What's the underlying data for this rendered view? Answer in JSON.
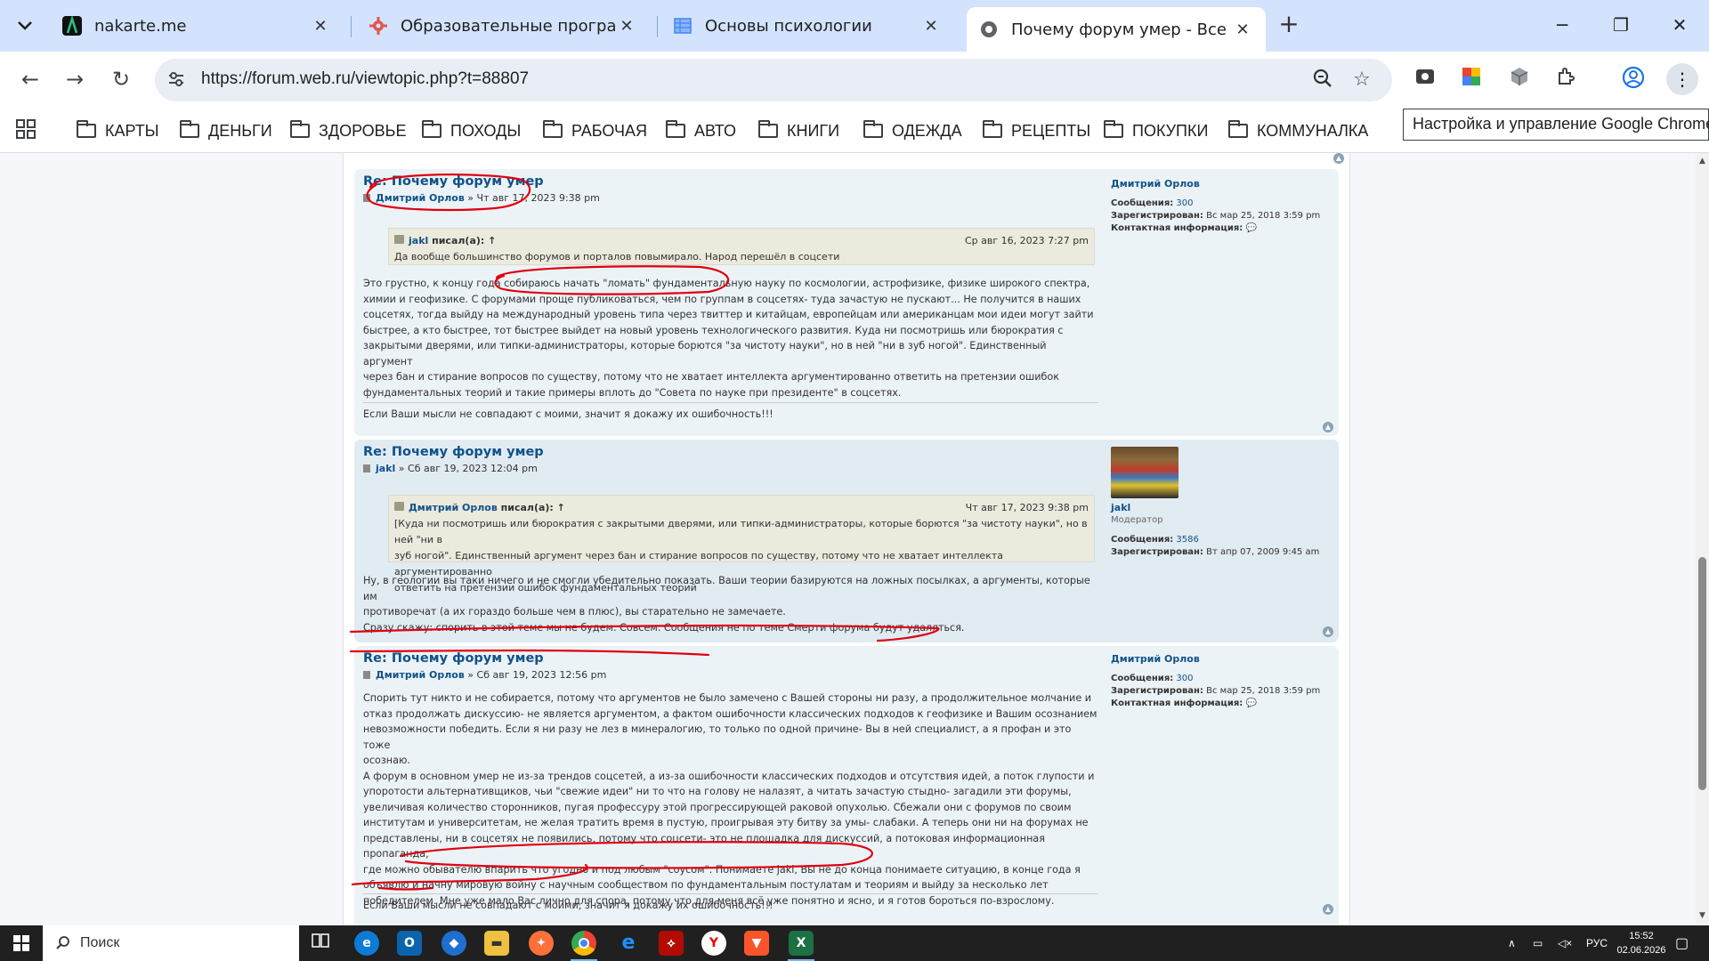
{
  "browser": {
    "tabs": [
      {
        "title": "nakarte.me",
        "favicon": "nakarte-icon",
        "active": false
      },
      {
        "title": "Образовательные программы",
        "favicon": "gear-red-icon",
        "active": false
      },
      {
        "title": "Основы психологии",
        "favicon": "document-grid-icon",
        "active": false
      },
      {
        "title": "Почему форум умер - Все о ге",
        "favicon": "globe-icon",
        "active": true
      }
    ],
    "url": "https://forum.web.ru/viewtopic.php?t=88807",
    "bookmarks": [
      "КАРТЫ",
      "ДЕНЬГИ",
      "ЗДОРОВЬЕ",
      "ПОХОДЫ",
      "РАБОЧАЯ",
      "АВТО",
      "КНИГИ",
      "ОДЕЖДА",
      "РЕЦЕПТЫ",
      "ПОКУПКИ",
      "КОММУНАЛКА"
    ],
    "tooltip": "Настройка и управление Google Chrome"
  },
  "posts": [
    {
      "title": "Re: Почему форум умер",
      "author": "Дмитрий Орлов",
      "date": "» Чт авг 17, 2023 9:38 pm",
      "quote": {
        "author": "jakl",
        "wrote": "писал(а): ↑",
        "date": "Ср авг 16, 2023 7:27 pm",
        "text": "Да вообще большинство форумов и порталов повымирало. Народ перешёл в соцсети"
      },
      "lines": [
        "Это грустно, к концу года собираюсь начать \"ломать\" фундаментальную науку по космологии, астрофизике, физике широкого спектра,",
        "химии и геофизике. С форумами проще публиковаться, чем по группам в соцсетях- туда зачастую не пускают... Не получится в наших",
        "соцсетях, тогда выйду на международный уровень типа через твиттер и китайцам, европейцам или американцам мои идеи могут зайти",
        "быстрее, а кто быстрее, тот быстрее выйдет на новый уровень технологического развития. Куда ни посмотришь или бюрократия с",
        "закрытыми дверями, или типки-администраторы, которые борются \"за чистоту науки\", но в ней \"ни в зуб ногой\". Единственный аргумент",
        "через бан и стирание вопросов по существу, потому что не хватает интеллекта аргументированно ответить на претензии ошибок",
        "фундаментальных теорий и такие примеры вплоть до \"Совета по науке при президенте\" в соцсетях."
      ],
      "signature": "Если Ваши мысли не совпадают с моими, значит я докажу их ошибочность!!!",
      "profile": {
        "name": "Дмитрий Орлов",
        "posts_label": "Сообщения:",
        "posts": "300",
        "reg_label": "Зарегистрирован:",
        "reg": "Вс мар 25, 2018 3:59 pm",
        "contact_label": "Контактная информация:"
      }
    },
    {
      "title": "Re: Почему форум умер",
      "author": "jakl",
      "date": "» Сб авг 19, 2023 12:04 pm",
      "quote": {
        "author": "Дмитрий Орлов",
        "wrote": "писал(а): ↑",
        "date": "Чт авг 17, 2023 9:38 pm",
        "lines": [
          "[Куда ни посмотришь или бюрократия с закрытыми дверями, или типки-администраторы, которые борются \"за чистоту науки\", но в ней \"ни в",
          "зуб ногой\". Единственный аргумент через бан и стирание вопросов по существу, потому что не хватает интеллекта аргументированно",
          "ответить на претензии ошибок фундаментальных теорий"
        ]
      },
      "lines": [
        "Ну, в геологии вы таки ничего и не смогли убедительно показать. Ваши теории базируются на ложных посылках, а аргументы, которые им",
        "противоречат (а их гораздо больше чем в плюс), вы старательно не замечаете.",
        "Сразу скажу: спорить в этой теме мы не будем. Совсем. Сообщения не по теме Смерти форума будут удаляться."
      ],
      "profile": {
        "name": "jakl",
        "rank": "Модератор",
        "posts_label": "Сообщения:",
        "posts": "3586",
        "reg_label": "Зарегистрирован:",
        "reg": "Вт апр 07, 2009 9:45 am"
      }
    },
    {
      "title": "Re: Почему форум умер",
      "author": "Дмитрий Орлов",
      "date": "» Сб авг 19, 2023 12:56 pm",
      "lines": [
        "Спорить тут никто и не собирается, потому что аргументов не было замечено с Вашей стороны ни разу, а продолжительное молчание и",
        "отказ продолжать дискуссию- не является аргументом, а фактом ошибочности классических подходов к геофизике и Вашим осознанием",
        "невозможности победить. Если я ни разу не лез в минералогию, то только по одной причине- Вы в ней специалист, а я профан и это тоже",
        "осознаю.",
        "А форум в основном умер не из-за трендов соцсетей, а из-за ошибочности классических подходов и отсутствия идей, а поток глупости и",
        "упоротости альтернативщиков, чьи \"свежие идеи\" ни то что на голову не налазят, а читать зачастую стыдно- загадили эти форумы,",
        "увеличивая количество сторонников, пугая профессуру этой прогрессирующей раковой опухолью. Сбежали они с форумов по своим",
        "институтам и университетам, не желая тратить время в пустую, проигрывая эту битву за умы- слабаки. А теперь они ни на форумах не",
        "представлены, ни в соцсетях не появились, потому что соцсети- это не площадка для дискуссий, а потоковая информационная пропаганда,",
        "где можно обывателю впарить что угодно и под любым \"соусом\". Понимаете jakl, Вы не до конца понимаете ситуацию, в конце года я",
        "объявлю и начну мировую войну с научным сообществом по фундаментальным постулатам и теориям и выйду за несколько лет",
        "победителем. Мне уже мало Вас лично для спора, потому что для меня всё уже понятно и ясно, и я готов бороться по-взрослому."
      ],
      "signature": "Если Ваши мысли не совпадают с моими, значит я докажу их ошибочность!!!",
      "profile": {
        "name": "Дмитрий Орлов",
        "posts_label": "Сообщения:",
        "posts": "300",
        "reg_label": "Зарегистрирован:",
        "reg": "Вс мар 25, 2018 3:59 pm",
        "contact_label": "Контактная информация:"
      }
    }
  ],
  "taskbar": {
    "search_placeholder": "Поиск",
    "language": "РУС",
    "time": "15:52",
    "date": "02.06.2026",
    "apps": [
      "task-view-icon",
      "edge-icon",
      "outlook-icon",
      "shield-app-icon",
      "file-explorer-icon",
      "firefox-icon",
      "chrome-icon",
      "ie-icon",
      "acrobat-icon",
      "yandex-icon",
      "brave-icon",
      "excel-icon"
    ]
  }
}
